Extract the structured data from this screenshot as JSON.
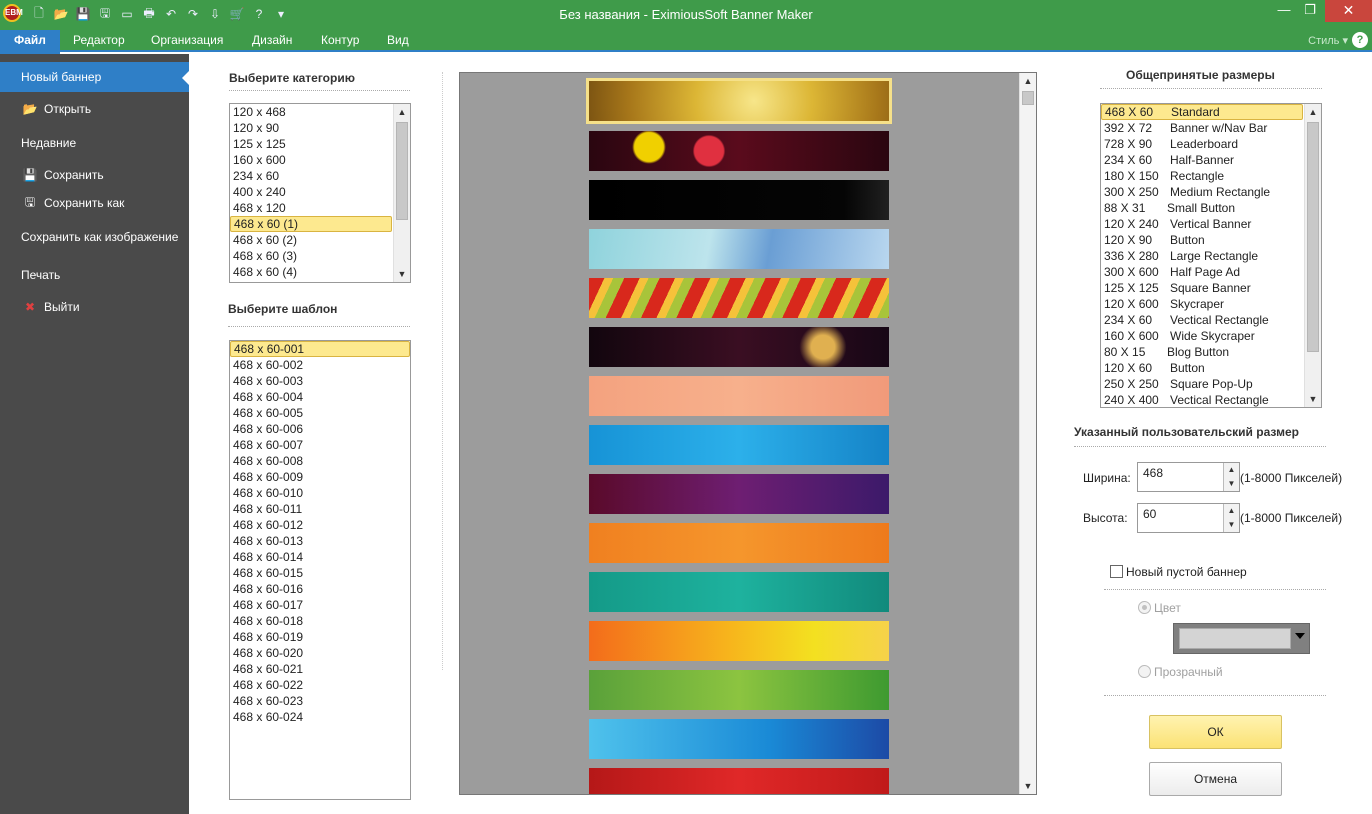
{
  "window": {
    "title": "Без названия - EximiousSoft Banner Maker",
    "app_icon_text": "EBM",
    "min": "—",
    "max": "❐",
    "close": "✕"
  },
  "qat": [
    "🗋",
    "📂",
    "💾",
    "🖫",
    "▭",
    "🖶",
    "↶",
    "↷",
    "⇩",
    "🛒",
    "?",
    "▾"
  ],
  "menu": {
    "items": [
      "Файл",
      "Редактор",
      "Организация",
      "Дизайн",
      "Контур",
      "Вид"
    ],
    "style": "Стиль ▾",
    "help": "?"
  },
  "nav": {
    "new_banner": "Новый баннер",
    "open": "Открыть",
    "recent": "Недавние",
    "save": "Сохранить",
    "save_as": "Сохранить как",
    "save_as_image": "Сохранить как изображение",
    "print": "Печать",
    "exit": "Выйти",
    "icons": {
      "open": "📂",
      "save": "💾",
      "save_as": "🖫",
      "exit": "✖"
    }
  },
  "category": {
    "title": "Выберите категорию",
    "items": [
      "120 x 468",
      "120 x 90",
      "125 x 125",
      "160 x 600",
      "234 x 60",
      "400 x 240",
      "468 x 120",
      "468 x 60 (1)",
      "468 x 60 (2)",
      "468 x 60 (3)",
      "468 x 60 (4)"
    ],
    "selected": "468 x 60 (1)"
  },
  "template": {
    "title": "Выберите шаблон",
    "items": [
      "468 x 60-001",
      "468 x 60-002",
      "468 x 60-003",
      "468 x 60-004",
      "468 x 60-005",
      "468 x 60-006",
      "468 x 60-007",
      "468 x 60-008",
      "468 x 60-009",
      "468 x 60-010",
      "468 x 60-011",
      "468 x 60-012",
      "468 x 60-013",
      "468 x 60-014",
      "468 x 60-015",
      "468 x 60-016",
      "468 x 60-017",
      "468 x 60-018",
      "468 x 60-019",
      "468 x 60-020",
      "468 x 60-021",
      "468 x 60-022",
      "468 x 60-023",
      "468 x 60-024"
    ],
    "selected": "468 x 60-001"
  },
  "preview": {
    "banner_count": 15,
    "selected_index": 0
  },
  "sizes": {
    "title": "Общепринятые размеры",
    "items": [
      [
        "468 X 60",
        "Standard"
      ],
      [
        "392 X 72",
        "Banner w/Nav Bar"
      ],
      [
        "728 X 90",
        "Leaderboard"
      ],
      [
        "234 X 60",
        "Half-Banner"
      ],
      [
        "180 X 150",
        "Rectangle"
      ],
      [
        "300 X 250",
        "Medium Rectangle"
      ],
      [
        "88 X 31",
        "Small Button"
      ],
      [
        "120 X 240",
        "Vertical Banner"
      ],
      [
        "120 X 90",
        "Button"
      ],
      [
        "336 X 280",
        "Large Rectangle"
      ],
      [
        "300 X 600",
        "Half Page Ad"
      ],
      [
        "125 X 125",
        "Square Banner"
      ],
      [
        "120 X 600",
        "Skycraper"
      ],
      [
        "234 X 60",
        "Vectical Rectangle"
      ],
      [
        "160 X 600",
        "Wide Skycraper"
      ],
      [
        "80 X 15",
        "Blog Button"
      ],
      [
        "120 X 60",
        "Button"
      ],
      [
        "250 X 250",
        "Square Pop-Up"
      ],
      [
        "240 X 400",
        "Vectical Rectangle"
      ]
    ],
    "selected": "468 X 60"
  },
  "custom": {
    "title": "Указанный пользовательский размер",
    "width_label": "Ширина:",
    "width_value": "468",
    "height_label": "Высота:",
    "height_value": "60",
    "range_hint": "(1-8000 Пикселей)"
  },
  "blank": {
    "label": "Новый пустой баннер",
    "checked": false,
    "color_label": "Цвет",
    "transparent_label": "Прозрачный"
  },
  "buttons": {
    "ok": "ОК",
    "cancel": "Отмена"
  },
  "colors": {
    "titlebar": "#3f9b4a",
    "accent": "#2f7fc7",
    "selection": "#fde98f"
  }
}
